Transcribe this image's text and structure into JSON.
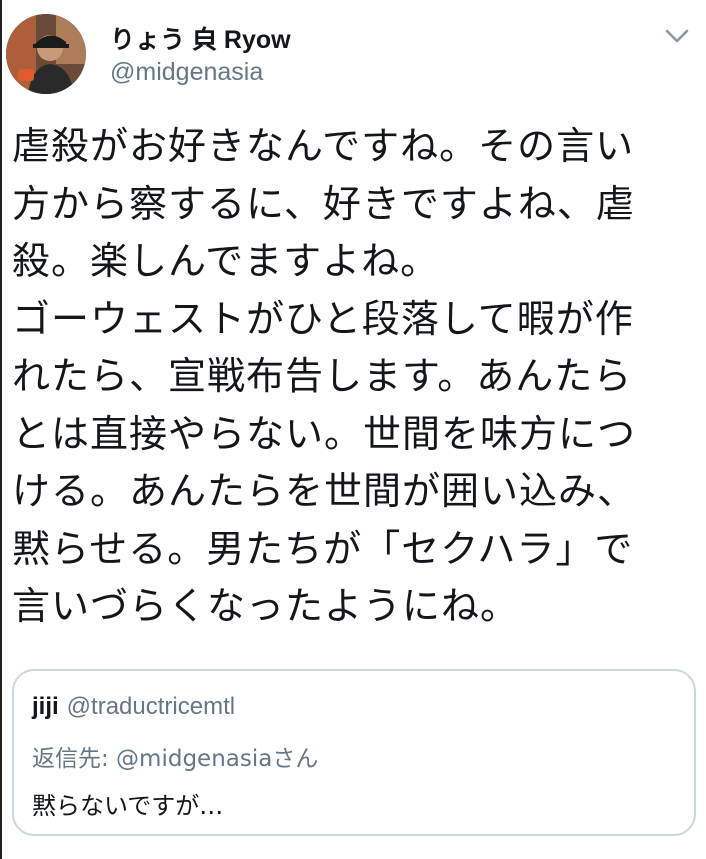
{
  "tweet": {
    "author": {
      "display_name": "りょう 㒵 Ryow",
      "handle": "@midgenasia"
    },
    "text": "虐殺がお好きなんですね。その言い\n方から察するに、好きですよね、虐\n殺。楽しんでますよね。\nゴーウェストがひと段落して暇が作\nれたら、宣戦布告します。あんたら\nとは直接やらない。世間を味方につ\nける。あんたらを世間が囲い込み、\n黙らせる。男たちが「セクハラ」で\n言いづらくなったようにね。",
    "menu_icon": "chevron-down-icon"
  },
  "quoted": {
    "display_name": "jiji",
    "handle": "@traductricemtl",
    "reply_to": "返信先: @midgenasiaさん",
    "text": "黙らないですが…"
  },
  "colors": {
    "text": "#14171a",
    "secondary": "#657786",
    "border": "#ccd6dd"
  }
}
